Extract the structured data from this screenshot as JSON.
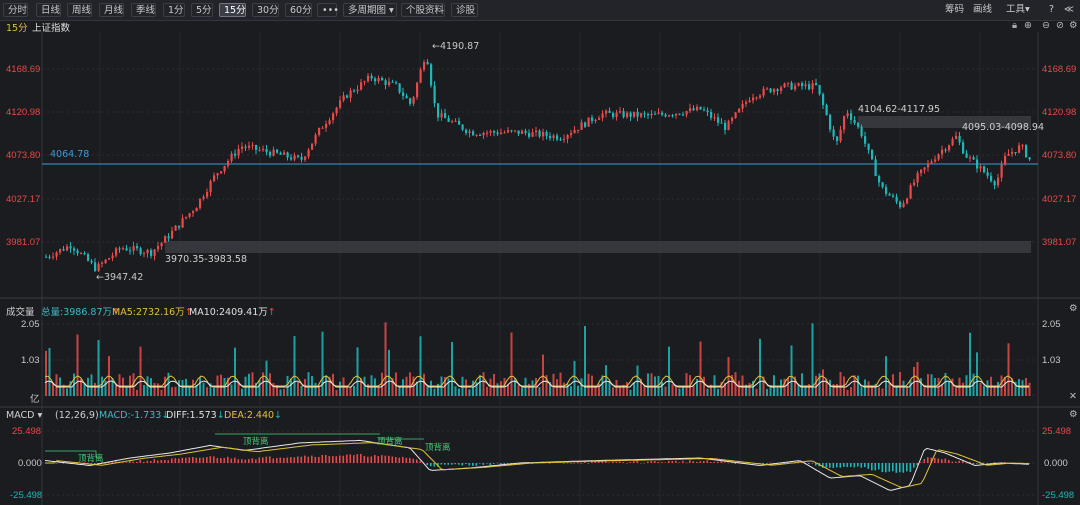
{
  "toolbar": {
    "buttons": [
      "分时",
      "日线",
      "周线",
      "月线",
      "季线",
      "1分",
      "5分",
      "15分",
      "30分",
      "60分",
      "•••",
      "多周期图 ▾",
      "个股资料",
      "诊股"
    ],
    "active_index": 7,
    "right_items": [
      "筹码",
      "画线",
      "工具▾"
    ]
  },
  "main_chart": {
    "period": "15分",
    "index_name": "上证指数",
    "y_ticks": [
      "4168.69",
      "4120.98",
      "4073.80",
      "4027.17",
      "3981.07"
    ],
    "y_tick_values": [
      4168.69,
      4120.98,
      4073.8,
      4027.17,
      3981.07
    ],
    "ref_line_label": "4064.78",
    "ref_line_value": 4064.78,
    "annotations": {
      "high": "4190.87",
      "low": "3947.42",
      "gap_low": "3970.35-3983.58",
      "gap_high_1": "4104.62-4117.95",
      "gap_high_2": "4095.03-4098.94"
    },
    "colors": {
      "up": "#e84a4a",
      "down": "#1fb8b8",
      "ref": "#3a9bdc"
    }
  },
  "volume_panel": {
    "title": "成交量",
    "total_label": "总量:3986.87万",
    "ma5_label": "MA5:2732.16万",
    "ma10_label": "MA10:2409.41万",
    "y_ticks": [
      "2.05",
      "1.03",
      "亿"
    ],
    "y_ticks_right": [
      "2.05",
      "1.03"
    ]
  },
  "macd_panel": {
    "title": "MACD ▾",
    "params": "(12,26,9)",
    "macd_label": "MACD:-1.733",
    "diff_label": "DIFF:1.573",
    "dea_label": "DEA:2.440",
    "y_ticks": [
      "25.498",
      "0.000",
      "-25.498"
    ],
    "signal_labels": [
      "顶背离",
      "顶背离",
      "顶背离",
      "顶背离"
    ]
  },
  "chart_data": {
    "type": "candlestick",
    "y_range": [
      3940,
      4200
    ],
    "high": 4190.87,
    "low": 3947.42
  }
}
